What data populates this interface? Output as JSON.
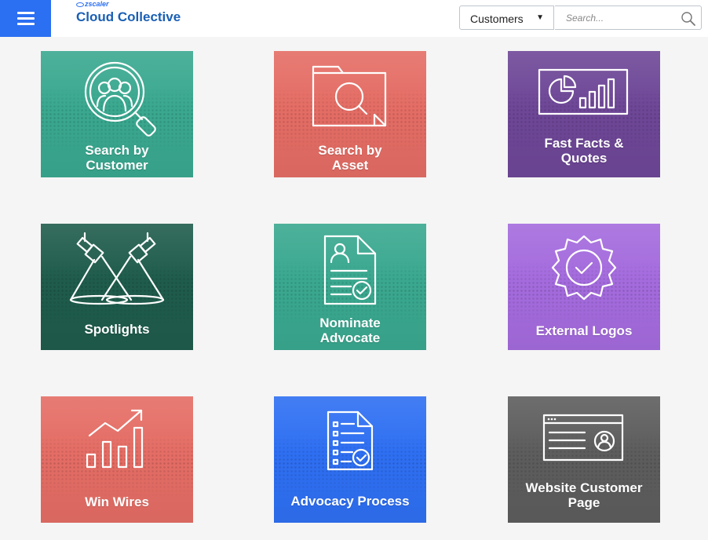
{
  "header": {
    "brand_small": "zscaler",
    "brand_title": "Cloud Collective",
    "filter_value": "Customers",
    "search_placeholder": "Search..."
  },
  "tiles": [
    {
      "label": "Search by\nCustomer",
      "icon": "search-customer-icon",
      "color": "#3aa88f"
    },
    {
      "label": "Search by\nAsset",
      "icon": "search-asset-icon",
      "color": "#e46d65"
    },
    {
      "label": "Fast Facts &\nQuotes",
      "icon": "chart-icon",
      "color": "#6e4797"
    },
    {
      "label": "Spotlights",
      "icon": "spotlight-icon",
      "color": "#1f5c4c"
    },
    {
      "label": "Nominate\nAdvocate",
      "icon": "nominate-doc-icon",
      "color": "#3aa88f"
    },
    {
      "label": "External Logos",
      "icon": "badge-icon",
      "color": "#a46bdd"
    },
    {
      "label": "Win Wires",
      "icon": "growth-chart-icon",
      "color": "#e46d65"
    },
    {
      "label": "Advocacy Process",
      "icon": "checklist-icon",
      "color": "#2e6ff2"
    },
    {
      "label": "Website Customer\nPage",
      "icon": "website-profile-icon",
      "color": "#5d5d5d"
    }
  ]
}
